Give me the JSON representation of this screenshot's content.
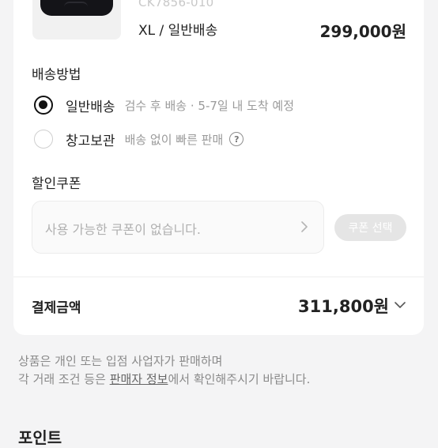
{
  "product": {
    "code": "CK7856-010",
    "option": "XL / 일반배송",
    "price": "299,000원"
  },
  "shipping": {
    "title": "배송방법",
    "options": [
      {
        "label": "일반배송",
        "desc": "검수 후 배송 · 5-7일 내 도착 예정",
        "selected": true
      },
      {
        "label": "창고보관",
        "desc": "배송 없이 빠른 판매",
        "selected": false
      }
    ]
  },
  "coupon": {
    "title": "할인쿠폰",
    "placeholder": "사용 가능한 쿠폰이 없습니다.",
    "button_label": "쿠폰 선택"
  },
  "payment": {
    "label": "결제금액",
    "amount": "311,800원"
  },
  "notice": {
    "line1": "상품은 개인 또는 입점 사업자가 판매하며",
    "line2_prefix": "각 거래 조건 등은 ",
    "line2_link": "판매자 정보",
    "line2_suffix": "에서 확인해주시기 바랍니다."
  },
  "next_section_title": "포인트",
  "icons": {
    "help": "help-circle-icon",
    "chevron_right": "chevron-right-icon",
    "chevron_down": "chevron-down-icon"
  }
}
